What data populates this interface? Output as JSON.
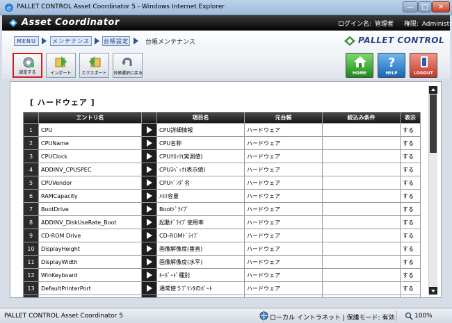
{
  "window": {
    "title": "PALLET CONTROL Asset Coordinator 5 - Windows Internet Explorer",
    "minimize": "—",
    "maximize": "□",
    "close": "✕"
  },
  "header": {
    "app_title": "Asset Coordinator",
    "login_label": "ログイン名:",
    "login_user": "管理者",
    "role_label": "権限:",
    "role_value": "Administrator"
  },
  "breadcrumb": {
    "items": [
      "MENU",
      "メンテナンス",
      "台帳設定"
    ],
    "current": "台帳メンテナンス",
    "brand": "PALLET CONTROL"
  },
  "toolbar": {
    "settings": "設定する",
    "import": "インポート",
    "export": "エクスポート",
    "back": "台帳選択に戻る",
    "home": "HOME",
    "help": "HELP",
    "logout": "LOGOUT"
  },
  "section": {
    "title": "[ ハードウェア ]"
  },
  "table": {
    "headers": [
      "エントリ名",
      "項目名",
      "元台帳",
      "絞込み条件",
      "表示"
    ],
    "rows": [
      {
        "num": "1",
        "entry": "CPU",
        "item": "CPU詳細情報",
        "source": "ハードウェア",
        "filter": "",
        "show": "する"
      },
      {
        "num": "2",
        "entry": "CPUName",
        "item": "CPU名称",
        "source": "ハードウェア",
        "filter": "",
        "show": "する"
      },
      {
        "num": "3",
        "entry": "CPUClock",
        "item": "CPUｸﾛｯｸ(実測値)",
        "source": "ハードウェア",
        "filter": "",
        "show": "する"
      },
      {
        "num": "4",
        "entry": "ADDINV_CPUSPEC",
        "item": "CPUｽﾍﾟｯｸ(表示値)",
        "source": "ハードウェア",
        "filter": "",
        "show": "する"
      },
      {
        "num": "5",
        "entry": "CPUVendor",
        "item": "CPUﾍﾞﾝﾀﾞ名",
        "source": "ハードウェア",
        "filter": "",
        "show": "する"
      },
      {
        "num": "6",
        "entry": "RAMCapacity",
        "item": "ﾒﾓﾘ容量",
        "source": "ハードウェア",
        "filter": "",
        "show": "する"
      },
      {
        "num": "7",
        "entry": "BootDrive",
        "item": "Bootﾄﾞﾗｲﾌﾞ",
        "source": "ハードウェア",
        "filter": "",
        "show": "する"
      },
      {
        "num": "8",
        "entry": "ADDINV_DiskUseRate_Boot",
        "item": "起動ﾄﾞﾗｲﾌﾞ使用率",
        "source": "ハードウェア",
        "filter": "",
        "show": "する"
      },
      {
        "num": "9",
        "entry": "CD-ROM Drive",
        "item": "CD-ROMﾄﾞﾗｲﾌﾞ",
        "source": "ハードウェア",
        "filter": "",
        "show": "する"
      },
      {
        "num": "10",
        "entry": "DisplayHeight",
        "item": "画像解像度(垂直)",
        "source": "ハードウェア",
        "filter": "",
        "show": "する"
      },
      {
        "num": "11",
        "entry": "DisplayWidth",
        "item": "画像解像度(水平)",
        "source": "ハードウェア",
        "filter": "",
        "show": "する"
      },
      {
        "num": "12",
        "entry": "WinKeyboard",
        "item": "ｷｰﾎﾞｰﾄﾞ種別",
        "source": "ハードウェア",
        "filter": "",
        "show": "する"
      },
      {
        "num": "13",
        "entry": "DefaultPrinterPort",
        "item": "通常使うﾌﾟﾘﾝﾀのﾎﾟｰﾄ",
        "source": "ハードウェア",
        "filter": "",
        "show": "する"
      },
      {
        "num": "",
        "entry": "",
        "item": "",
        "source": "",
        "filter": "",
        "show": ""
      }
    ]
  },
  "status": {
    "left": "PALLET CONTROL Asset Coordinator 5",
    "zone": "ローカル イントラネット | 保護モード: 有効",
    "zoom": "100%"
  },
  "colors": {
    "accent": "#2d4fa0",
    "header_bg": "#111111",
    "active_border": "#d21c1c"
  }
}
